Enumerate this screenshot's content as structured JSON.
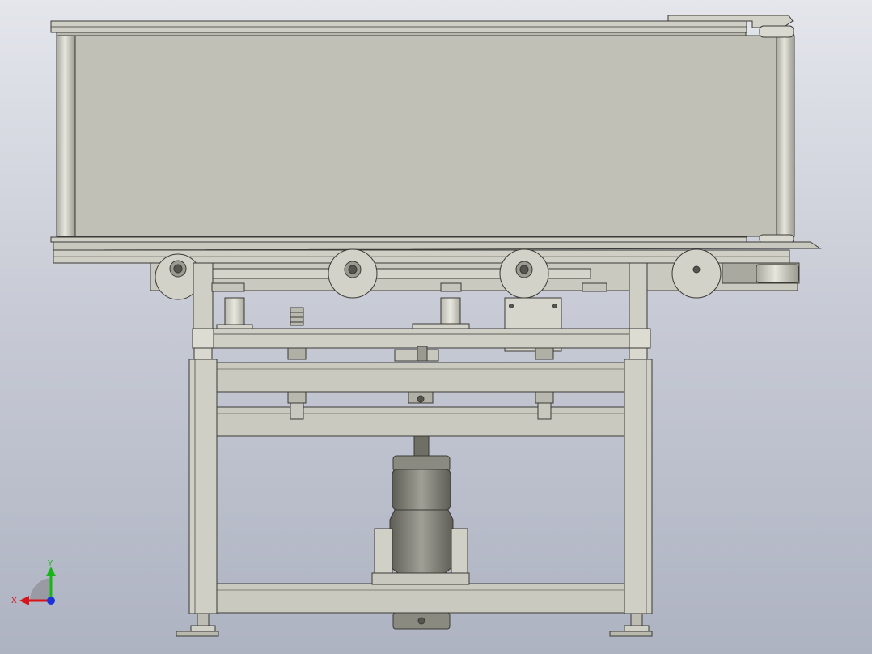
{
  "viewport": {
    "background_top": "#e4e6ec",
    "background_bottom": "#aeb3c2"
  },
  "model": {
    "part_fill": "#c0c0b6",
    "part_fill_light": "#d6d6cc",
    "part_fill_dark": "#8f8f86",
    "edge_color": "#3a3a36",
    "motor_fill": "#7d7d74"
  },
  "triad": {
    "x_label": "X",
    "y_label": "Y",
    "x_color": "#d8141a",
    "y_color": "#19b419",
    "z_color": "#1a33d8"
  }
}
